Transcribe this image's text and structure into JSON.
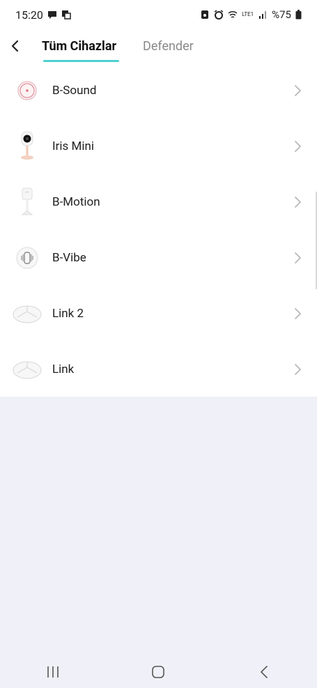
{
  "status_bar": {
    "time": "15:20",
    "battery": "%75",
    "network": "LTE1",
    "icons": [
      "chat-icon",
      "screen-mirror-icon",
      "sim-lock-icon",
      "alarm-icon",
      "wifi-icon",
      "volte-icon",
      "signal-icon",
      "battery-icon"
    ]
  },
  "header": {
    "tabs": [
      {
        "label": "Tüm Cihazlar",
        "active": true
      },
      {
        "label": "Defender",
        "active": false
      }
    ],
    "accent_color": "#4fd0d0"
  },
  "devices": [
    {
      "label": "B-Sound",
      "icon": "b-sound-device-icon"
    },
    {
      "label": "Iris Mini",
      "icon": "iris-mini-camera-icon"
    },
    {
      "label": "B-Motion",
      "icon": "b-motion-sensor-icon"
    },
    {
      "label": "B-Vibe",
      "icon": "b-vibe-sensor-icon"
    },
    {
      "label": "Link 2",
      "icon": "link-2-hub-icon"
    },
    {
      "label": "Link",
      "icon": "link-hub-icon"
    }
  ],
  "nav": {
    "buttons": [
      "recent-apps-icon",
      "home-icon",
      "back-icon"
    ]
  }
}
